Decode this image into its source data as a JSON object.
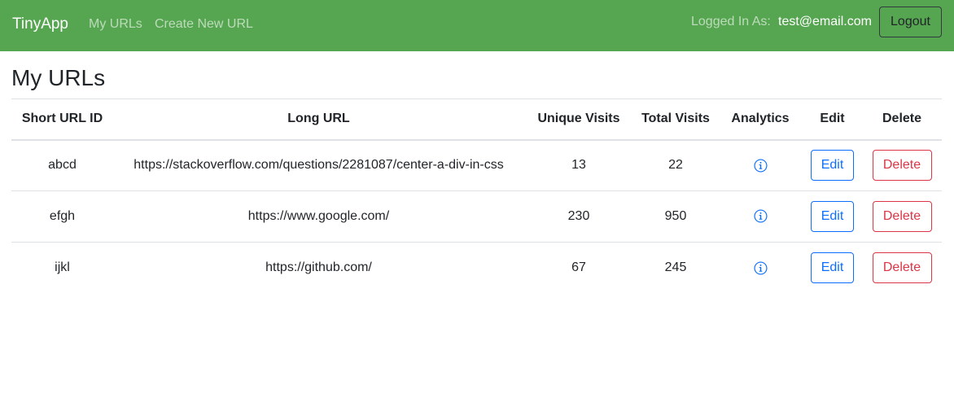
{
  "navbar": {
    "brand": "TinyApp",
    "links": [
      "My URLs",
      "Create New URL"
    ],
    "logged_in_label": "Logged In As:",
    "user_email": "test@email.com",
    "logout_label": "Logout",
    "background_color": "#56a551"
  },
  "page": {
    "title": "My URLs"
  },
  "table": {
    "headers": [
      "Short URL ID",
      "Long URL",
      "Unique Visits",
      "Total Visits",
      "Analytics",
      "Edit",
      "Delete"
    ],
    "rows": [
      {
        "short_id": "abcd",
        "long_url": "https://stackoverflow.com/questions/2281087/center-a-div-in-css",
        "unique_visits": "13",
        "total_visits": "22",
        "analytics_icon": "info-circle-icon",
        "edit_label": "Edit",
        "delete_label": "Delete"
      },
      {
        "short_id": "efgh",
        "long_url": "https://www.google.com/",
        "unique_visits": "230",
        "total_visits": "950",
        "analytics_icon": "info-circle-icon",
        "edit_label": "Edit",
        "delete_label": "Delete"
      },
      {
        "short_id": "ijkl",
        "long_url": "https://github.com/",
        "unique_visits": "67",
        "total_visits": "245",
        "analytics_icon": "info-circle-icon",
        "edit_label": "Edit",
        "delete_label": "Delete"
      }
    ]
  },
  "colors": {
    "edit_button": "#0d6efd",
    "delete_button": "#dc3545",
    "analytics_icon": "#0d6efd"
  }
}
